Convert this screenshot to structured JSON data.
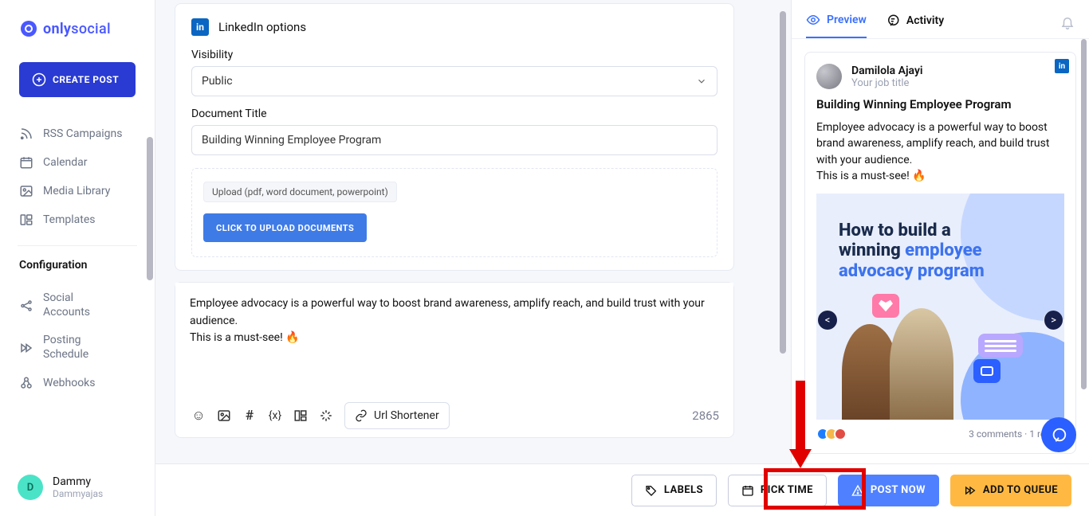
{
  "brand": {
    "name_bold": "only",
    "name_rest": "social"
  },
  "sidebar": {
    "create_label": "CREATE POST",
    "items": [
      {
        "label": "RSS Campaigns"
      },
      {
        "label": "Calendar"
      },
      {
        "label": "Media Library"
      },
      {
        "label": "Templates"
      }
    ],
    "config_heading": "Configuration",
    "config_items": [
      {
        "label": "Social Accounts"
      },
      {
        "label": "Posting Schedule"
      },
      {
        "label": "Webhooks"
      }
    ],
    "user": {
      "initial": "D",
      "name": "Dammy",
      "sub": "Dammyajas"
    }
  },
  "editor": {
    "linkedin_label": "LinkedIn options",
    "visibility_label": "Visibility",
    "visibility_value": "Public",
    "doc_title_label": "Document Title",
    "doc_title_value": "Building Winning Employee Program",
    "upload_hint": "Upload (pdf, word document, powerpoint)",
    "upload_button": "CLICK TO UPLOAD DOCUMENTS",
    "body_text": "Employee advocacy is a powerful way to boost brand awareness, amplify reach, and build trust with your audience.\nThis is a must-see! 🔥",
    "url_shortener": "Url Shortener",
    "char_counter": "2865"
  },
  "right": {
    "tab_preview": "Preview",
    "tab_activity": "Activity",
    "profile_name": "Damilola Ajayi",
    "profile_sub": "Your job title",
    "headline": "Building Winning Employee Program",
    "body": "Employee advocacy is a powerful way to boost brand awareness, amplify reach, and build trust with your audience.\nThis is a must-see! 🔥",
    "image_heading_line1": "How to build a",
    "image_heading_line2a": "winning ",
    "image_heading_line2b": "employee",
    "image_heading_line3": "advocacy program",
    "stats": "3 comments · 1 repost"
  },
  "actions": {
    "labels": "LABELS",
    "pick_time": "PICK TIME",
    "post_now": "POST NOW",
    "add_queue": "ADD TO QUEUE"
  }
}
